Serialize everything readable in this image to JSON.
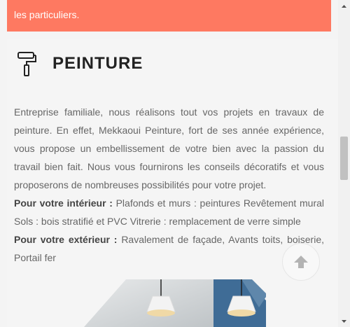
{
  "banner": {
    "text": "les particuliers."
  },
  "section": {
    "icon": "paint-roller-icon",
    "title": "PEINTURE",
    "paragraph1": "Entreprise familiale, nous réalisons tout vos projets en travaux de peinture. En effet, Mekkaoui Peinture, fort de ses année expérience, vous propose un embellissement de votre bien avec la passion du travail bien fait. Nous vous fournirons les conseils décoratifs et vous proposerons de nombreuses possibilités pour votre projet.",
    "interior_label": "Pour votre intérieur :",
    "interior_text": " Plafonds et murs : peintures Revêtement mural Sols : bois stratifié et PVC Vitrerie : remplacement de verre simple",
    "exterior_label": "Pour votre extérieur :",
    "exterior_text": " Ravalement de façade, Avants toits, boiserie, Portail fer"
  },
  "scroll_top": {
    "icon": "arrow-up-icon"
  },
  "colors": {
    "banner": "#fe7961",
    "background": "#f5f5f5",
    "text": "#666666",
    "title": "#222222"
  }
}
